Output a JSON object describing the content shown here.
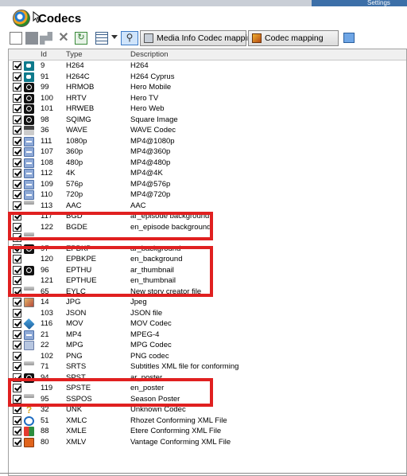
{
  "window": {
    "title": "Codecs",
    "corner_text": "Settings"
  },
  "toolbar": {
    "media_info_label": "Media Info Codec mapping",
    "codec_mapping_label": "Codec mapping"
  },
  "grid": {
    "columns": [
      "Id",
      "Type",
      "Description"
    ],
    "rows": [
      {
        "checked": true,
        "icon": "h264-icon",
        "id": "9",
        "type": "H264",
        "desc": "H264"
      },
      {
        "checked": true,
        "icon": "h264-icon",
        "id": "91",
        "type": "H264C",
        "desc": "H264 Cyprus"
      },
      {
        "checked": true,
        "icon": "camera-icon",
        "id": "99",
        "type": "HRMOB",
        "desc": "Hero Mobile"
      },
      {
        "checked": true,
        "icon": "camera-icon",
        "id": "100",
        "type": "HRTV",
        "desc": "Hero TV"
      },
      {
        "checked": true,
        "icon": "camera-icon",
        "id": "101",
        "type": "HRWEB",
        "desc": "Hero Web"
      },
      {
        "checked": true,
        "icon": "camera-icon",
        "id": "98",
        "type": "SQIMG",
        "desc": "Square Image"
      },
      {
        "checked": true,
        "icon": "wave-icon",
        "id": "36",
        "type": "WAVE",
        "desc": "WAVE Codec"
      },
      {
        "checked": true,
        "icon": "mp4-icon",
        "id": "111",
        "type": "1080p",
        "desc": "MP4@1080p"
      },
      {
        "checked": true,
        "icon": "mp4-icon",
        "id": "107",
        "type": "360p",
        "desc": "MP4@360p"
      },
      {
        "checked": true,
        "icon": "mp4-icon",
        "id": "108",
        "type": "480p",
        "desc": "MP4@480p"
      },
      {
        "checked": true,
        "icon": "mp4-icon",
        "id": "112",
        "type": "4K",
        "desc": "MP4@4K"
      },
      {
        "checked": true,
        "icon": "mp4-icon",
        "id": "109",
        "type": "576p",
        "desc": "MP4@576p"
      },
      {
        "checked": true,
        "icon": "mp4-icon",
        "id": "110",
        "type": "720p",
        "desc": "MP4@720p"
      },
      {
        "checked": true,
        "icon": "cut-icon",
        "id": "113",
        "type": "AAC",
        "desc": "AAC"
      },
      {
        "checked": true,
        "icon": "none",
        "id": "117",
        "type": "BGD",
        "desc": "ar_episode background"
      },
      {
        "checked": true,
        "icon": "none",
        "id": "122",
        "type": "BGDE",
        "desc": "en_episode background"
      },
      {
        "checked": true,
        "icon": "cut-icon",
        "id": "",
        "type": "",
        "desc": ""
      },
      {
        "checked": true,
        "icon": "camera-icon",
        "id": "97",
        "type": "EPBKP",
        "desc": "ar_background"
      },
      {
        "checked": true,
        "icon": "none",
        "id": "120",
        "type": "EPBKPE",
        "desc": "en_background"
      },
      {
        "checked": true,
        "icon": "camera-icon",
        "id": "96",
        "type": "EPTHU",
        "desc": "ar_thumbnail"
      },
      {
        "checked": true,
        "icon": "none",
        "id": "121",
        "type": "EPTHUE",
        "desc": "en_thumbnail"
      },
      {
        "checked": true,
        "icon": "cut-icon",
        "id": "65",
        "type": "EYLC",
        "desc": "New story creator file"
      },
      {
        "checked": true,
        "icon": "jpg-icon",
        "id": "14",
        "type": "JPG",
        "desc": "Jpeg"
      },
      {
        "checked": true,
        "icon": "none",
        "id": "103",
        "type": "JSON",
        "desc": "JSON file"
      },
      {
        "checked": true,
        "icon": "mov-icon",
        "id": "116",
        "type": "MOV",
        "desc": "MOV Codec"
      },
      {
        "checked": true,
        "icon": "mp4-icon",
        "id": "21",
        "type": "MP4",
        "desc": "MPEG-4"
      },
      {
        "checked": true,
        "icon": "mpg-icon",
        "id": "22",
        "type": "MPG",
        "desc": "MPG Codec"
      },
      {
        "checked": true,
        "icon": "none",
        "id": "102",
        "type": "PNG",
        "desc": "PNG codec"
      },
      {
        "checked": true,
        "icon": "cut-icon",
        "id": "71",
        "type": "SRTS",
        "desc": "Subtitles XML file for conforming"
      },
      {
        "checked": true,
        "icon": "camera-icon",
        "id": "94",
        "type": "SPST",
        "desc": "ar_poster"
      },
      {
        "checked": true,
        "icon": "none",
        "id": "119",
        "type": "SPSTE",
        "desc": "en_poster"
      },
      {
        "checked": true,
        "icon": "cut-icon",
        "id": "95",
        "type": "SSPOS",
        "desc": "Season Poster"
      },
      {
        "checked": true,
        "icon": "question-icon",
        "id": "32",
        "type": "UNK",
        "desc": "Unknown Codec"
      },
      {
        "checked": true,
        "icon": "rhozet-icon",
        "id": "51",
        "type": "XMLC",
        "desc": "Rhozet Conforming XML File"
      },
      {
        "checked": true,
        "icon": "etere-icon",
        "id": "88",
        "type": "XMLE",
        "desc": "Etere Conforming XML File"
      },
      {
        "checked": true,
        "icon": "vantage-icon",
        "id": "80",
        "type": "XMLV",
        "desc": "Vantage Conforming XML File"
      }
    ]
  },
  "colors": {
    "highlight": "#e02020",
    "accent": "#3d7bc7"
  }
}
